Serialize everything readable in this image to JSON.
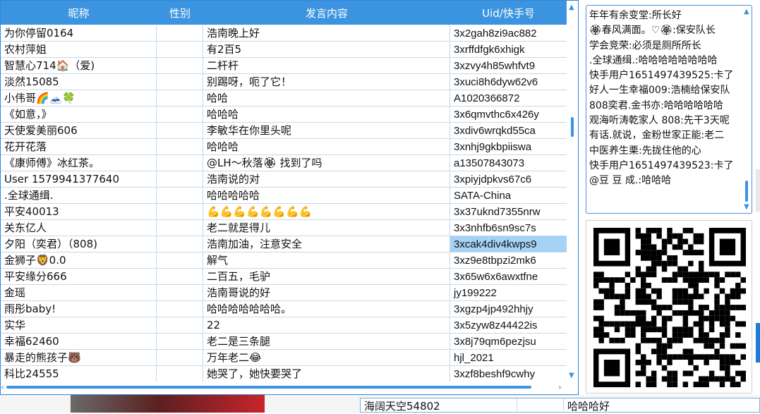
{
  "table": {
    "headers": {
      "nickname": "昵称",
      "gender": "性别",
      "message": "发言内容",
      "uid": "Uid/快手号"
    },
    "rows": [
      {
        "nickname": "为你停留0164",
        "gender": "",
        "message": "浩南晚上好",
        "uid": "3x2gah8zi9ac882"
      },
      {
        "nickname": "农村萍姐",
        "gender": "",
        "message": "有2百5",
        "uid": "3xrffdfgk6xhigk"
      },
      {
        "nickname": "智慧心714🏠（爱)",
        "gender": "",
        "message": "二杆杆",
        "uid": "3xzvy4h85whfvt9"
      },
      {
        "nickname": "淡然15085",
        "gender": "",
        "message": "别踢呀，呃了它！",
        "uid": "3xuci8h6dyw62v6"
      },
      {
        "nickname": "小伟哥🌈🗻🍀",
        "gender": "",
        "message": "哈哈",
        "uid": "A1020366872"
      },
      {
        "nickname": "《如意，》",
        "gender": "",
        "message": "哈哈哈",
        "uid": "3x6qmvthc6x426y"
      },
      {
        "nickname": "天使爱美丽606",
        "gender": "",
        "message": "李敏华在你里头呢",
        "uid": "3xdiv6wrqkd55ca"
      },
      {
        "nickname": "花开花落",
        "gender": "",
        "message": "哈哈哈",
        "uid": "3xnhj9gkbpiiswa"
      },
      {
        "nickname": "《康师傅》冰红茶。",
        "gender": "",
        "message": "@LH～秋落🏵 找到了吗",
        "uid": "a13507843073"
      },
      {
        "nickname": "User 1579941377640",
        "gender": "",
        "message": "浩南说的对",
        "uid": "3xpiyjdpkvs67c6"
      },
      {
        "nickname": ".全球通缉.",
        "gender": "",
        "message": "哈哈哈哈哈",
        "uid": "SATA-China"
      },
      {
        "nickname": "平安40013",
        "gender": "",
        "message": "💪💪💪💪💪💪💪💪",
        "uid": "3x37uknd7355nrw"
      },
      {
        "nickname": "关东亿人",
        "gender": "",
        "message": "老二就是得儿",
        "uid": "3x3nhfb6sn9sc7s"
      },
      {
        "nickname": "夕阳（奕君）（808)",
        "gender": "",
        "message": "浩南加油，注意安全",
        "uid": "3xcak4div4kwps9",
        "selected": true
      },
      {
        "nickname": "金狮子🦁0.0",
        "gender": "",
        "message": "解气",
        "uid": "3xz9e8tbpzi2mk6"
      },
      {
        "nickname": "平安缘分666",
        "gender": "",
        "message": "二百五，毛驴",
        "uid": "3x65w6x6awxtfne"
      },
      {
        "nickname": "金瑶",
        "gender": "",
        "message": "浩南哥说的好",
        "uid": "jy199222"
      },
      {
        "nickname": "雨彤baby!",
        "gender": "",
        "message": "哈哈哈哈哈哈哈。",
        "uid": "3xgzp4jp492hhjy"
      },
      {
        "nickname": "实华",
        "gender": "",
        "message": "22",
        "uid": "3x5zyw8z44422is"
      },
      {
        "nickname": "幸福62460",
        "gender": "",
        "message": "老二是三条腿",
        "uid": "3x8j79qm6pezjsu"
      },
      {
        "nickname": "暴走的熊孩子🐻",
        "gender": "",
        "message": "万年老二😂",
        "uid": "hjl_2021"
      },
      {
        "nickname": "科比24555",
        "gender": "",
        "message": "她哭了，她快要哭了",
        "uid": "3xzf8beshf9cwhy"
      }
    ]
  },
  "chat": {
    "lines": [
      "年年有余变堂:所长好",
      "🏵春风满面。♡🏵:保安队长",
      "学会竞荣:必须是厕所所长",
      ".全球通缉.:哈哈哈哈哈哈哈哈",
      "快手用户1651497439525:卡了",
      "好人一生幸福009:浩楠给保安队",
      "808奕君.金书亦:哈哈哈哈哈哈",
      "观海听涛乾家人 808:先干3天呢",
      "有话.就说，金粉世家正能:老二",
      "中医养生栗:先拢住他的心",
      "快手用户1651497439523:卡了",
      "@豆 豆 成.:哈哈哈"
    ]
  },
  "bottom_row": {
    "nickname": "海阔天空54802",
    "message": "哈哈哈好"
  },
  "colors": {
    "header_bg": "#3c94e0",
    "selection": "#a6d2f6",
    "accent": "#2f86d6"
  },
  "icons": {
    "scroll_up": "chevron-up-icon",
    "scroll_down": "chevron-down-icon",
    "scroll_left": "chevron-left-icon",
    "scroll_right": "chevron-right-icon",
    "qr": "qr-code-icon"
  }
}
